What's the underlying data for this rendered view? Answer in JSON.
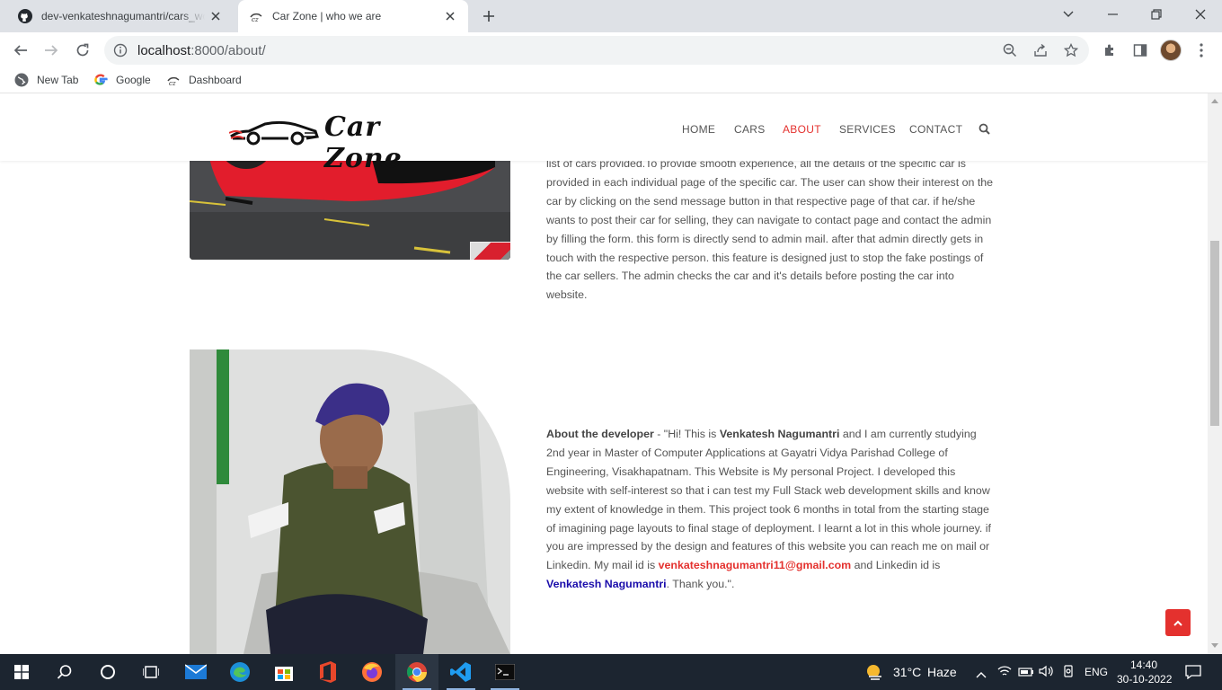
{
  "browser": {
    "tabs": [
      {
        "title": "dev-venkateshnagumantri/cars_wor",
        "icon": "github-icon",
        "active": false
      },
      {
        "title": "Car Zone | who we are",
        "icon": "carzone-favicon",
        "active": true
      }
    ],
    "url_host": "localhost",
    "url_path": ":8000/about/",
    "bookmarks": [
      {
        "label": "New Tab",
        "icon": "globe-icon"
      },
      {
        "label": "Google",
        "icon": "google-icon"
      },
      {
        "label": "Dashboard",
        "icon": "carzone-favicon"
      }
    ]
  },
  "site": {
    "brand": "Car Zone",
    "nav": [
      {
        "label": "HOME",
        "active": false
      },
      {
        "label": "CARS",
        "active": false
      },
      {
        "label": "ABOUT",
        "active": true
      },
      {
        "label": "SERVICES",
        "active": false
      },
      {
        "label": "CONTACT",
        "active": false
      }
    ],
    "accent_color": "#e4312e",
    "about_text": "list of cars provided.To provide smooth experience, all the details of the specific car is provided in each individual page of the specific car. The user can show their interest on the car by clicking on the send message button in that respective page of that car. if he/she wants to post their car for selling, they can navigate to contact page and contact the admin by filling the form. this form is directly send to admin mail. after that admin directly gets in touch with the respective person. this feature is designed just to stop the fake postings of the car sellers. The admin checks the car and it's details before posting the car into website.",
    "developer": {
      "label": "About the developer",
      "sep": " - \"Hi! This is ",
      "name": "Venkatesh Nagumantri",
      "bio": " and I am currently studying 2nd year in Master of Computer Applications at Gayatri Vidya Parishad College of Engineering, Visakhapatnam. This Website is My personal Project. I developed this website with self-interest so that i can test my Full Stack web development skills and know my extent of knowledge in them. This project took 6 months in total from the starting stage of imagining page layouts to final stage of deployment. I learnt a lot in this whole journey. if you are impressed by the design and features of this website you can reach me on mail or Linkedin. My mail id is ",
      "email": "venkateshnagumantri11@gmail.com",
      "mid": " and Linkedin id is ",
      "linkedin": "Venkatesh Nagumantri",
      "end": ". Thank you.\"."
    }
  },
  "taskbar": {
    "weather_temp": "31°C",
    "weather_cond": "Haze",
    "lang": "ENG",
    "time": "14:40",
    "date": "30-10-2022"
  }
}
